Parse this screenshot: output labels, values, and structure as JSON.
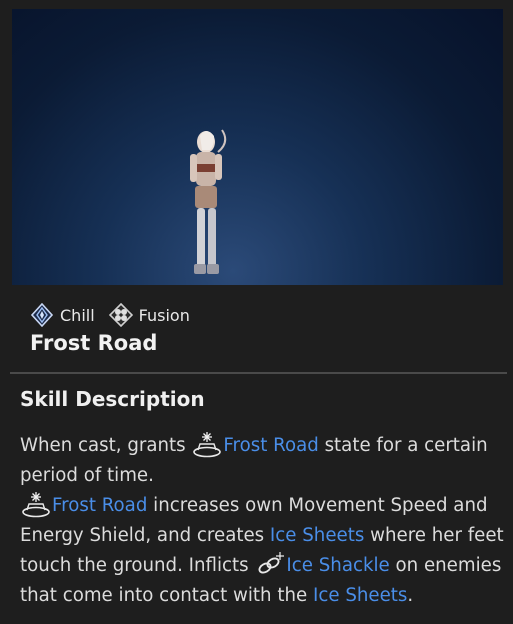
{
  "tags": [
    {
      "label": "Chill",
      "icon": "chill-element-icon"
    },
    {
      "label": "Fusion",
      "icon": "fusion-skill-icon"
    }
  ],
  "skill_name": "Frost Road",
  "section_title": "Skill Description",
  "description": {
    "p1_a": "When cast, grants ",
    "p1_link": "Frost Road",
    "p1_b": " state for a certain period of time.",
    "p2_link1": "Frost Road",
    "p2_a": " increases own Movement Speed and Energy Shield, and creates ",
    "p2_link2": "Ice Sheets",
    "p2_b": " where her feet touch the ground. Inflicts ",
    "p2_link3": "Ice Shackle",
    "p2_c": " on enemies that come into contact with the ",
    "p2_link4": "Ice Sheets",
    "p2_d": "."
  },
  "colors": {
    "highlight": "#4a8ee8",
    "background": "#1e1e1e"
  }
}
